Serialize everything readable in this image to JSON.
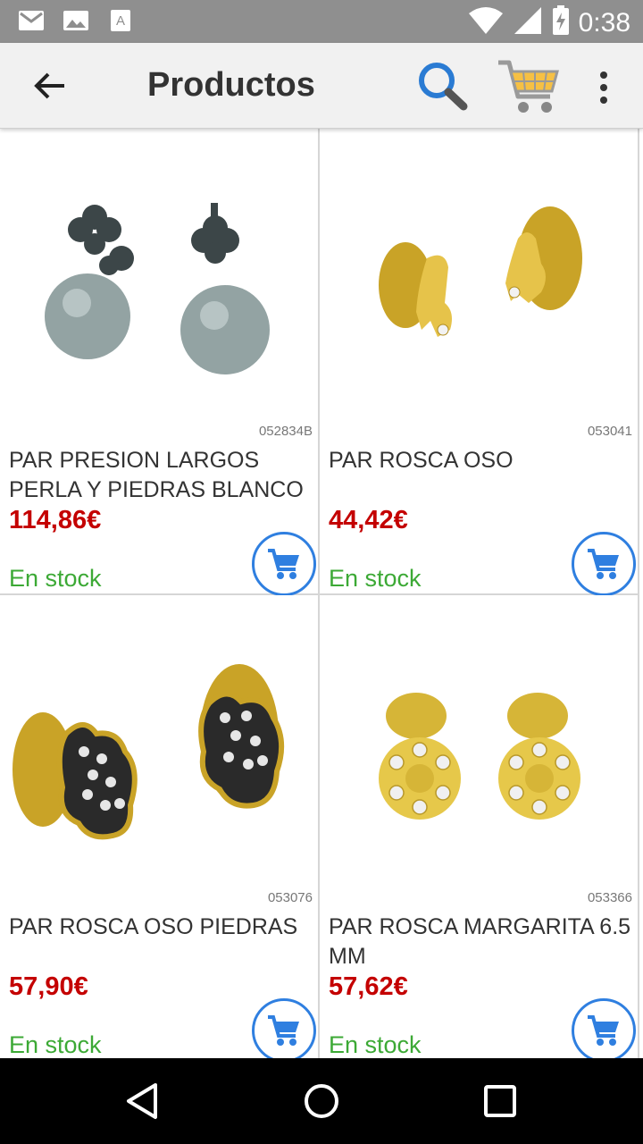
{
  "status_bar": {
    "time": "0:38",
    "icons": [
      "gmail-icon",
      "photo-icon",
      "font-download-icon",
      "wifi-icon",
      "cell-signal-icon",
      "battery-charging-icon"
    ]
  },
  "app_bar": {
    "title": "Productos",
    "back_icon": "arrow-back-icon",
    "search_icon": "search-icon",
    "cart_icon": "shopping-cart-icon",
    "more_icon": "more-vert-icon"
  },
  "products": [
    {
      "code": "052834B",
      "name": "PAR PRESION LARGOS PERLA Y PIEDRAS BLANCO",
      "price": "114,86€",
      "stock": "En stock",
      "image": "pearl-earrings"
    },
    {
      "code": "053041",
      "name": "PAR ROSCA OSO",
      "price": "44,42€",
      "stock": "En stock",
      "image": "gold-bear-earrings"
    },
    {
      "code": "053076",
      "name": "PAR ROSCA OSO PIEDRAS",
      "price": "57,90€",
      "stock": "En stock",
      "image": "stone-bear-earrings"
    },
    {
      "code": "053366",
      "name": "PAR ROSCA MARGARITA 6.5 MM",
      "price": "57,62€",
      "stock": "En stock",
      "image": "daisy-earrings"
    }
  ],
  "colors": {
    "price": "#c40000",
    "stock": "#3ca935",
    "accent": "#2f7fe0",
    "status_bar": "#8f8f8f",
    "app_bar": "#f1f1f1"
  },
  "nav_bar": [
    "back-triangle-icon",
    "home-circle-icon",
    "recents-square-icon"
  ]
}
